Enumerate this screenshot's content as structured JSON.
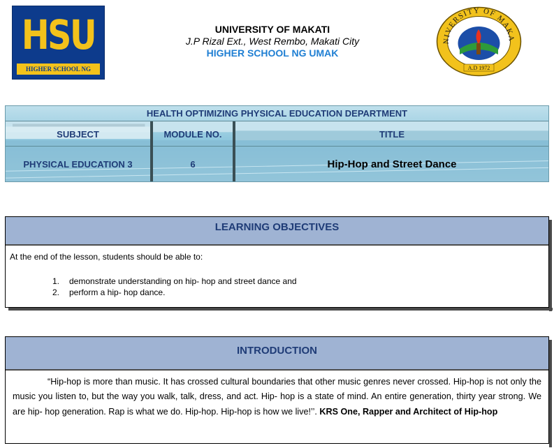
{
  "header": {
    "logo_letters": "HSU",
    "logo_caption": "HIGHER SCHOOL NG UMAK",
    "university": "UNIVERSITY OF MAKATI",
    "address": "J.P Rizal Ext., West Rembo, Makati City",
    "school": "HIGHER SCHOOL NG UMAK",
    "seal_ring_text": "UNIVERSITY OF MAKATI",
    "seal_year": "A.D 1972"
  },
  "department": {
    "title": "HEALTH OPTIMIZING PHYSICAL EDUCATION DEPARTMENT",
    "headers": {
      "subject": "SUBJECT",
      "module": "MODULE NO.",
      "title": "TITLE"
    },
    "values": {
      "subject": "PHYSICAL EDUCATION 3",
      "module": "6",
      "title": "Hip-Hop and  Street Dance"
    }
  },
  "objectives": {
    "heading": "LEARNING OBJECTIVES",
    "intro": "At the end of the lesson, students should be able to:",
    "items": [
      {
        "num": "1.",
        "text": "demonstrate understanding on hip- hop and street dance and"
      },
      {
        "num": "2.",
        "text": "perform a hip- hop dance."
      }
    ]
  },
  "introduction": {
    "heading": "INTRODUCTION",
    "quote": "“Hip-hop is more than music. It has crossed cultural boundaries that other music genres never crossed. Hip-hop is not only the music you listen to, but the way you walk, talk, dress, and act. Hip- hop is a state of mind. An entire generation, thirty year strong. We are hip- hop generation. Rap is what we do. Hip-hop. Hip-hop is how we live!’’.",
    "attribution": "KRS One, Rapper and Architect of Hip-hop"
  },
  "colors": {
    "logo_blue": "#0d3b8c",
    "logo_gold": "#f3c21b",
    "school_blue": "#1f7fd3",
    "section_bar": "#9fb3d3",
    "table_text": "#1f3c77"
  }
}
